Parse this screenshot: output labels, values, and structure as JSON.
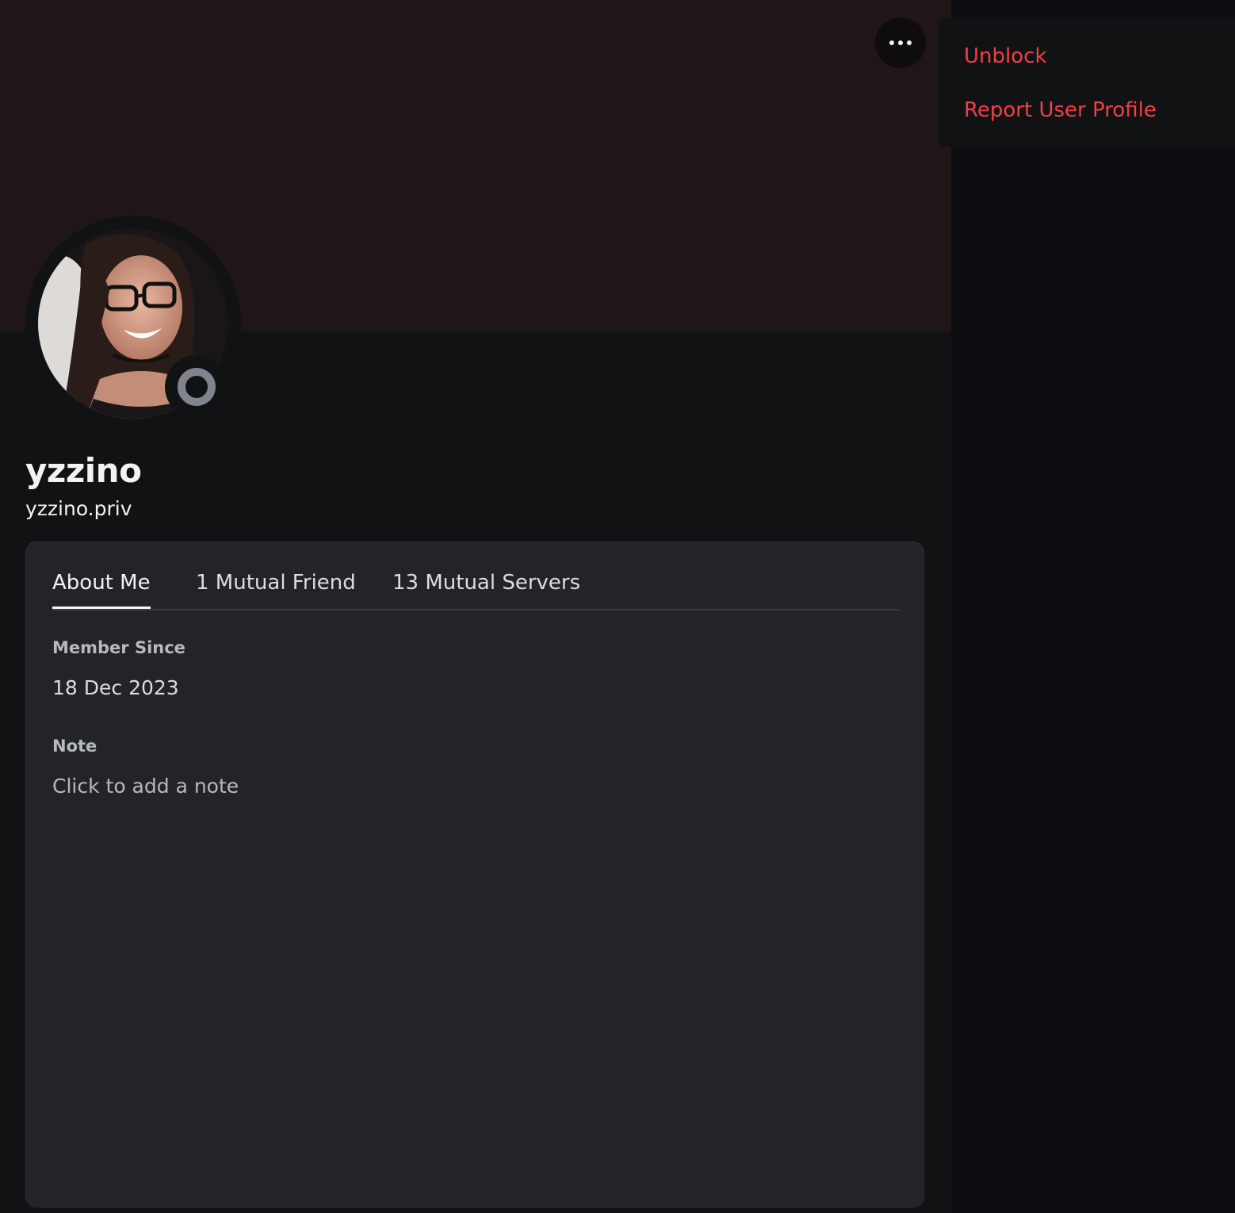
{
  "profile": {
    "display_name": "yzzino",
    "username": "yzzino.priv",
    "status": "offline"
  },
  "tabs": [
    {
      "label": "About Me",
      "active": true
    },
    {
      "label": "1 Mutual Friend",
      "active": false
    },
    {
      "label": "13 Mutual Servers",
      "active": false
    }
  ],
  "about": {
    "member_since_label": "Member Since",
    "member_since_value": "18 Dec 2023",
    "note_label": "Note",
    "note_placeholder": "Click to add a note"
  },
  "context_menu": {
    "items": [
      {
        "label": "Unblock"
      },
      {
        "label": "Report User Profile"
      }
    ]
  },
  "colors": {
    "banner": "#201617",
    "danger": "#f23f43",
    "card": "#232428",
    "status_offline": "#80848e"
  },
  "icons": {
    "more": "more-dots-icon",
    "status": "offline-status-icon"
  }
}
